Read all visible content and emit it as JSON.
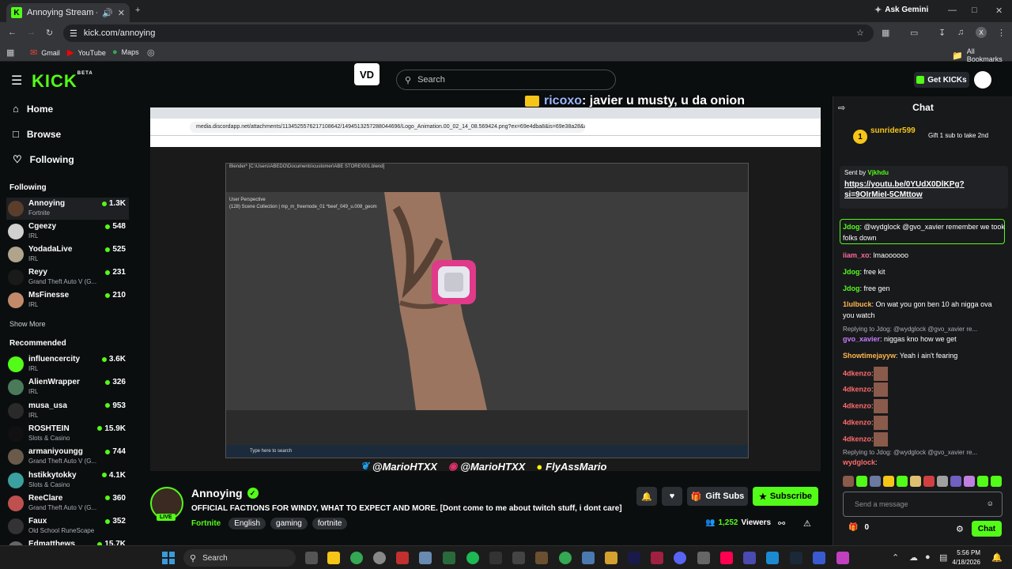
{
  "browser": {
    "tab_title": "Annoying Stream - Watch l",
    "url": "kick.com/annoying",
    "ask_gemini": "Ask Gemini",
    "all_bookmarks": "All Bookmarks",
    "bookmarks": [
      {
        "label": "Gmail",
        "icon": "gmail-icon"
      },
      {
        "label": "YouTube",
        "icon": "youtube-icon"
      },
      {
        "label": "Maps",
        "icon": "maps-icon"
      }
    ]
  },
  "header": {
    "logo": "KICK",
    "logo_beta": "BETA",
    "search_placeholder": "Search",
    "get_kicks": "Get KICKs"
  },
  "sidebar": {
    "nav": [
      {
        "label": "Home",
        "icon": "home-icon"
      },
      {
        "label": "Browse",
        "icon": "browse-icon"
      },
      {
        "label": "Following",
        "icon": "heart-icon"
      }
    ],
    "following_heading": "Following",
    "following": [
      {
        "name": "Annoying",
        "category": "Fortnite",
        "viewers": "1.3K",
        "color": "#5a3d2b"
      },
      {
        "name": "Cgeezy",
        "category": "IRL",
        "viewers": "548",
        "color": "#d0d0d0"
      },
      {
        "name": "YodadaLive",
        "category": "IRL",
        "viewers": "525",
        "color": "#b0a48c"
      },
      {
        "name": "Reyy",
        "category": "Grand Theft Auto V (G...",
        "viewers": "231",
        "color": "#1a1a1a"
      },
      {
        "name": "MsFinesse",
        "category": "IRL",
        "viewers": "210",
        "color": "#c28a6a"
      }
    ],
    "show_more": "Show More",
    "recommended_heading": "Recommended",
    "recommended": [
      {
        "name": "influencercity",
        "category": "IRL",
        "viewers": "3.6K",
        "color": "#53fc18"
      },
      {
        "name": "AlienWrapper",
        "category": "IRL",
        "viewers": "326",
        "color": "#4a7a5a"
      },
      {
        "name": "musa_usa",
        "category": "IRL",
        "viewers": "953",
        "color": "#2a2a2a"
      },
      {
        "name": "ROSHTEIN",
        "category": "Slots & Casino",
        "viewers": "15.9K",
        "color": "#111111"
      },
      {
        "name": "armaniyoungg",
        "category": "Grand Theft Auto V (G...",
        "viewers": "744",
        "color": "#6a5a4a"
      },
      {
        "name": "hstikkytokky",
        "category": "Slots & Casino",
        "viewers": "4.1K",
        "color": "#3aa0a0"
      },
      {
        "name": "ReeClare",
        "category": "Grand Theft Auto V (G...",
        "viewers": "360",
        "color": "#c05050"
      },
      {
        "name": "Faux",
        "category": "Old School RuneScape",
        "viewers": "352",
        "color": "#333333"
      },
      {
        "name": "Edmatthews",
        "category": "",
        "viewers": "15.7K",
        "color": "#666666"
      }
    ]
  },
  "stream_overlay": {
    "chat_user": "ricoxo",
    "chat_text": ": javier u musty, u da onion",
    "socials": [
      "@MarioHTXX",
      "@MarioHTXX",
      "FlyAssMario"
    ],
    "inner_url": "media.discordapp.net/attachments/1134525576217108642/1494513257288044696/Logo_Animation.00_02_14_08.569424.png?ex=69e4dba8&is=69e38a28&hm=1a257315...",
    "blender_title": "Blender* [C:\\Users\\ABEDO\\Documents\\customer\\ABE STORE\\001.blend]",
    "blender_info_1": "User Perspective",
    "blender_info_2": "(128) Scene Collection | mp_m_freemode_01 *beef_049_u.008_geom",
    "inner_search": "Type here to search"
  },
  "stream_info": {
    "name": "Annoying",
    "live": "LIVE",
    "title": "OFFICIAL FACTIONS FOR WINDY, WHAT TO EXPECT AND MORE.  [Dont come to me about twitch stuff, i dont care]",
    "category": "Fortnite",
    "tags": [
      "English",
      "gaming",
      "fortnite"
    ],
    "gift_subs": "Gift Subs",
    "subscribe": "Subscribe",
    "viewers": "1,252",
    "viewers_label": "Viewers"
  },
  "chat": {
    "heading": "Chat",
    "pinned_user": "sunrider599",
    "pinned_text": "Gift 1 sub to take 2nd",
    "sent_by_label": "Sent by",
    "sent_by_user": "Vjkhdu",
    "sent_link_1": "https://youtu.be/0YUdX0DlKPg?",
    "sent_link_2": "si=9OIrMieI-5CMttow",
    "messages": [
      {
        "user": "Jdog",
        "text": ": @wydglock @gvo_xavier remember we took folks down",
        "color": "#53fc18"
      },
      {
        "user": "iiam_xo",
        "text": ": lmaoooooo",
        "color": "#ff6b9d"
      },
      {
        "user": "Jdog",
        "text": ": free kit",
        "color": "#53fc18"
      },
      {
        "user": "Jdog",
        "text": ": free gen",
        "color": "#53fc18"
      },
      {
        "user": "1lulbuck",
        "text": ": On wat you gon ben 10 ah nigga ova you watch",
        "color": "#ffb84d"
      },
      {
        "user": "gvo_xavier",
        "text": ": niggas kno how we get",
        "color": "#c77dff"
      },
      {
        "user": "Showtimejayyw",
        "text": ": Yeah i ain't fearing",
        "color": "#ffb84d"
      },
      {
        "user": "4dkenzo",
        "text": ":",
        "color": "#ff6b6b"
      },
      {
        "user": "4dkenzo",
        "text": ":",
        "color": "#ff6b6b"
      },
      {
        "user": "4dkenzo",
        "text": ":",
        "color": "#ff6b6b"
      },
      {
        "user": "4dkenzo",
        "text": ":",
        "color": "#ff6b6b"
      },
      {
        "user": "4dkenzo",
        "text": ":",
        "color": "#ff6b6b"
      },
      {
        "user": "wydglock",
        "text": ":",
        "color": "#ff6b6b"
      }
    ],
    "reply_1": "Replying to Jdog: @wydglock @gvo_xavier re...",
    "reply_2": "Replying to Jdog: @wydglock @gvo_xavier re...",
    "input_placeholder": "Send a message",
    "kicks_count": "0",
    "chat_button": "Chat"
  },
  "taskbar": {
    "search": "Search",
    "time": "5:56 PM",
    "date": "4/18/2026"
  }
}
